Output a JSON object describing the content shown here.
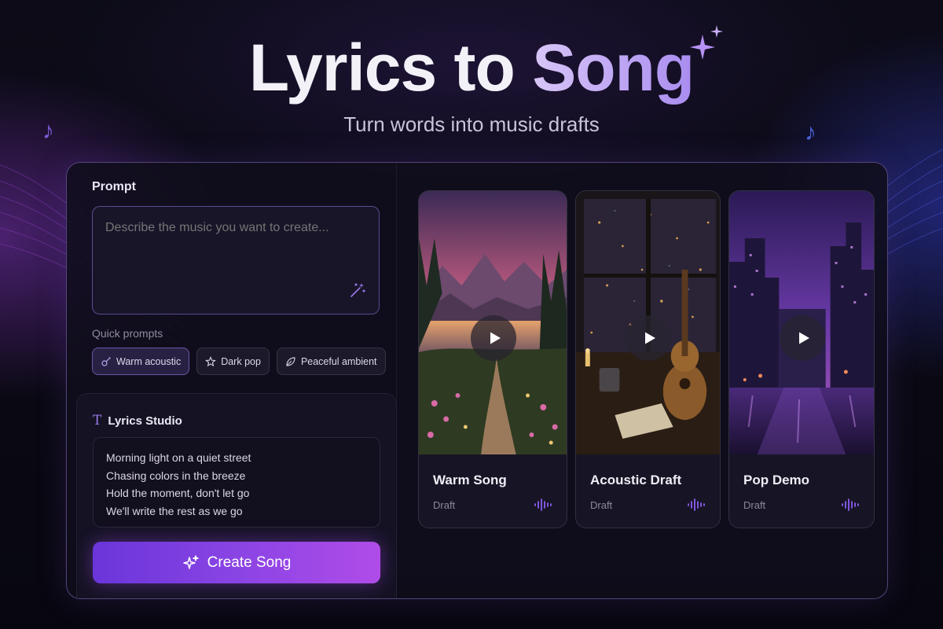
{
  "hero": {
    "title_part1": "Lyrics to",
    "title_part2": "Song",
    "subtitle": "Turn words into music drafts"
  },
  "prompt": {
    "label": "Prompt",
    "placeholder": "Describe the music you want to create...",
    "magic_icon": "magic-wand-icon"
  },
  "quick_prompts": {
    "label": "Quick prompts",
    "chips": [
      {
        "label": "Warm acoustic",
        "icon": "guitar-icon",
        "active": true
      },
      {
        "label": "Dark pop",
        "icon": "star-icon",
        "active": false
      },
      {
        "label": "Peaceful ambient",
        "icon": "leaf-icon",
        "active": false
      }
    ]
  },
  "lyrics_studio": {
    "title": "Lyrics Studio",
    "icon": "text-icon",
    "lines": [
      "Morning light on a quiet street",
      "Chasing colors in the breeze",
      "Hold the moment, don't let go",
      "We'll write the rest as we go"
    ]
  },
  "create_button": {
    "label": "Create Song",
    "icon": "sparkle-icon"
  },
  "cards": [
    {
      "title": "Warm Song",
      "status": "Draft",
      "art": "mountain-sunset-lake"
    },
    {
      "title": "Acoustic Draft",
      "status": "Draft",
      "art": "window-guitar-night"
    },
    {
      "title": "Pop Demo",
      "status": "Draft",
      "art": "neon-city-night"
    }
  ],
  "colors": {
    "accent": "#8a44e4",
    "accent_light": "#a98cf0",
    "background": "#0a0912"
  }
}
